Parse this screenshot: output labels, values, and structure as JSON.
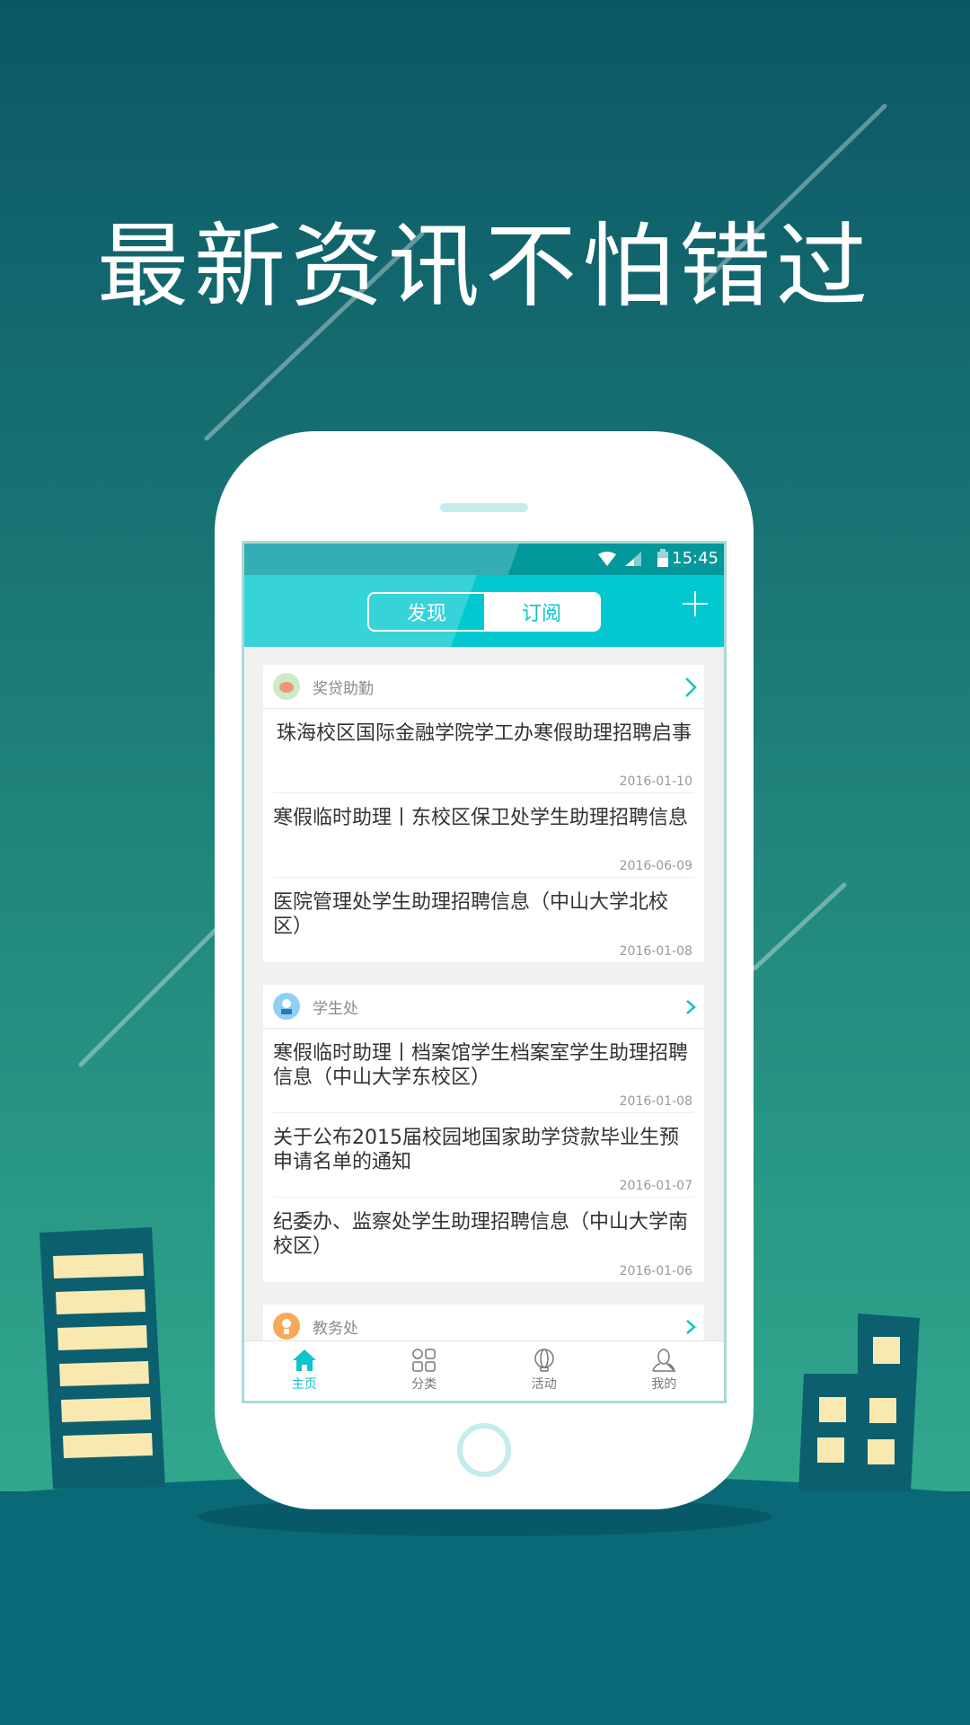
{
  "headline": "最新资讯不怕错过",
  "colors": {
    "accent": "#03c8cf",
    "background_top": "#0b5766",
    "background_bottom": "#2fa58c",
    "building": "#0c5f6e",
    "window": "#f9e9b0"
  },
  "status_bar": {
    "time": "15:45",
    "icons": [
      "wifi-icon",
      "signal-icon",
      "battery-icon"
    ]
  },
  "header": {
    "tabs": [
      {
        "label": "发现",
        "selected": true
      },
      {
        "label": "订阅",
        "selected": false
      }
    ],
    "add_icon": "plus-icon"
  },
  "cards": [
    {
      "label": "奖贷助勤",
      "icon": "piggy-bank-icon",
      "items": [
        {
          "title": "珠海校区国际金融学院学工办寒假助理招聘启事",
          "date": "2016-01-10"
        },
        {
          "title": "寒假临时助理丨东校区保卫处学生助理招聘信息",
          "date": "2016-06-09"
        },
        {
          "title": "医院管理处学生助理招聘信息（中山大学北校区）",
          "date": "2016-01-08"
        }
      ]
    },
    {
      "label": "学生处",
      "icon": "student-avatar-icon",
      "items": [
        {
          "title": "寒假临时助理丨档案馆学生档案室学生助理招聘信息（中山大学东校区）",
          "date": "2016-01-08"
        },
        {
          "title": "关于公布2015届校园地国家助学贷款毕业生预申请名单的通知",
          "date": "2016-01-07"
        },
        {
          "title": "纪委办、监察处学生助理招聘信息（中山大学南校区）",
          "date": "2016-01-06"
        }
      ]
    },
    {
      "label": "教务处",
      "icon": "teacher-avatar-icon",
      "items": []
    }
  ],
  "nav": [
    {
      "label": "主页",
      "icon": "home-icon",
      "active": true
    },
    {
      "label": "分类",
      "icon": "grid-icon"
    },
    {
      "label": "活动",
      "icon": "balloon-icon"
    },
    {
      "label": "我的",
      "icon": "user-icon"
    }
  ]
}
